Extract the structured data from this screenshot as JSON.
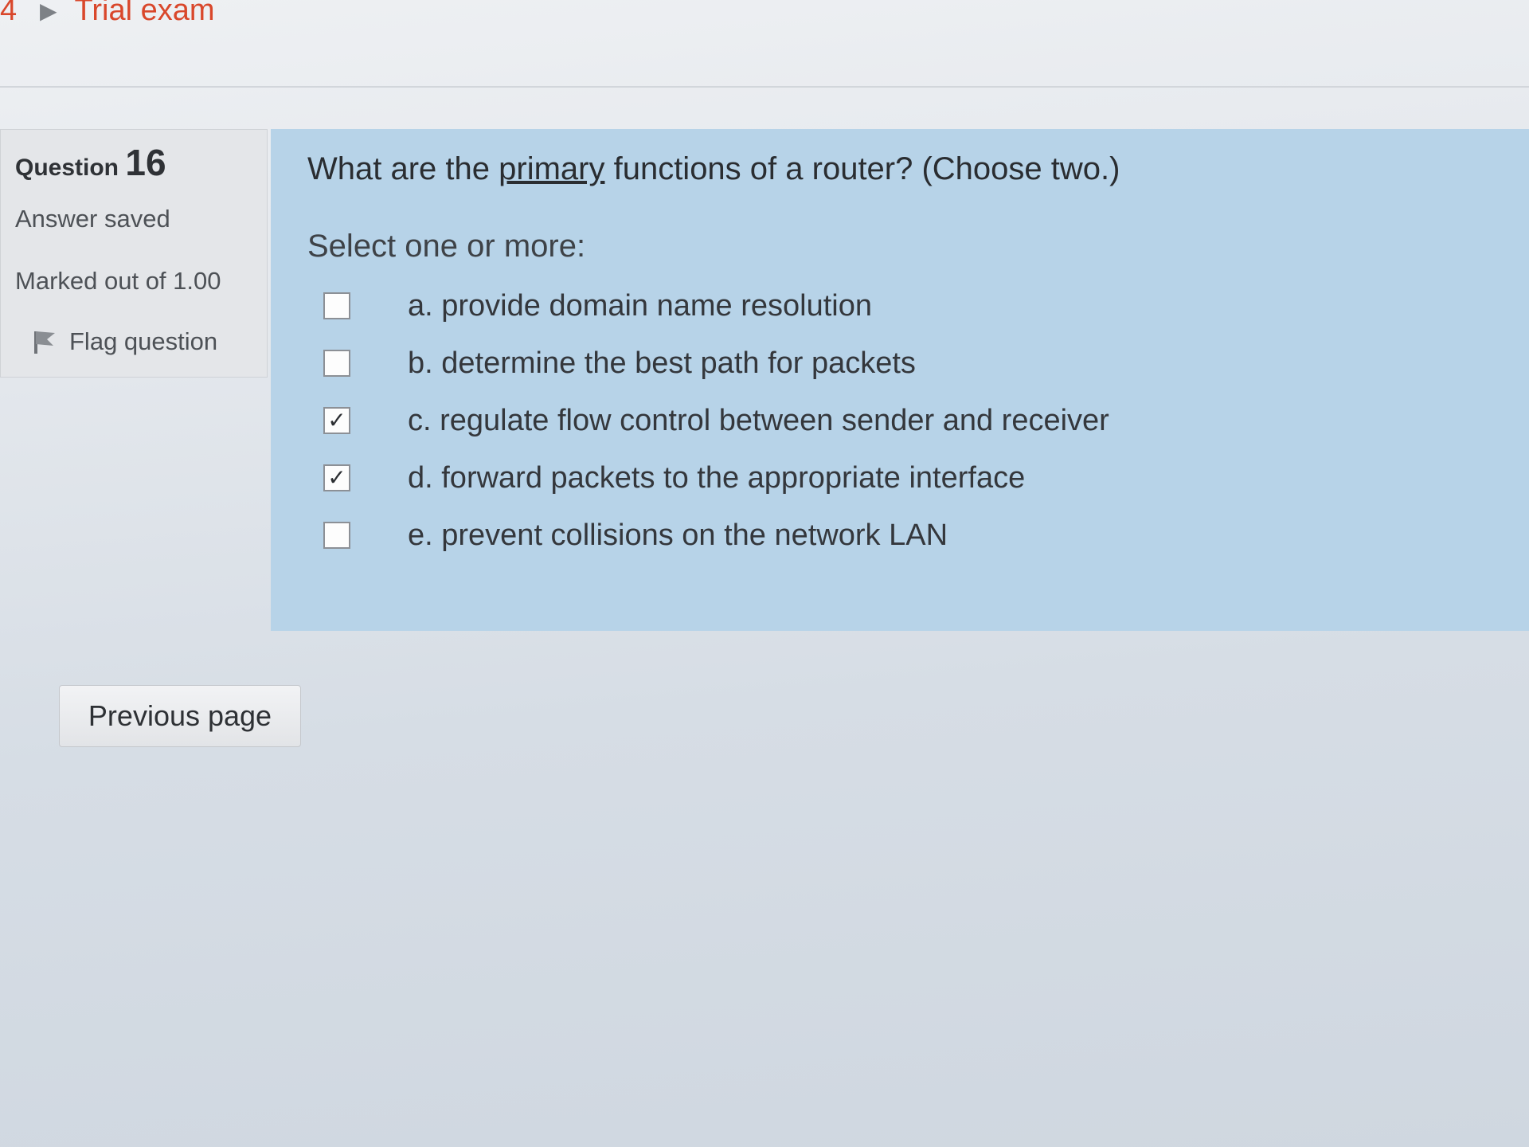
{
  "breadcrumb": {
    "number": "4",
    "separator": "▶",
    "current": "Trial exam"
  },
  "question_info": {
    "label": "Question",
    "number": "16",
    "status": "Answer saved",
    "marked": "Marked out of 1.00",
    "flag_label": "Flag question"
  },
  "question": {
    "text_before": "What are the ",
    "text_emphasis": "primary",
    "text_after": " functions of a router? (Choose two.)",
    "prompt": "Select one or more:",
    "answers": [
      {
        "label": "a. provide domain name resolution",
        "checked": false,
        "mark": ""
      },
      {
        "label": "b. determine the best path for packets",
        "checked": false,
        "mark": ""
      },
      {
        "label": "c. regulate flow control between sender and receiver",
        "checked": true,
        "mark": "✓"
      },
      {
        "label": "d. forward packets to the appropriate interface",
        "checked": true,
        "mark": "✓"
      },
      {
        "label": "e. prevent collisions on the network LAN",
        "checked": false,
        "mark": ""
      }
    ]
  },
  "navigation": {
    "previous_label": "Previous page"
  },
  "colors": {
    "content_bg": "#b7d3e8",
    "info_bg": "#e4e6e9",
    "breadcrumb_link": "#d9472b"
  },
  "icons": {
    "flag": "flag-icon",
    "breadcrumb_separator": "triangle-right-icon"
  }
}
